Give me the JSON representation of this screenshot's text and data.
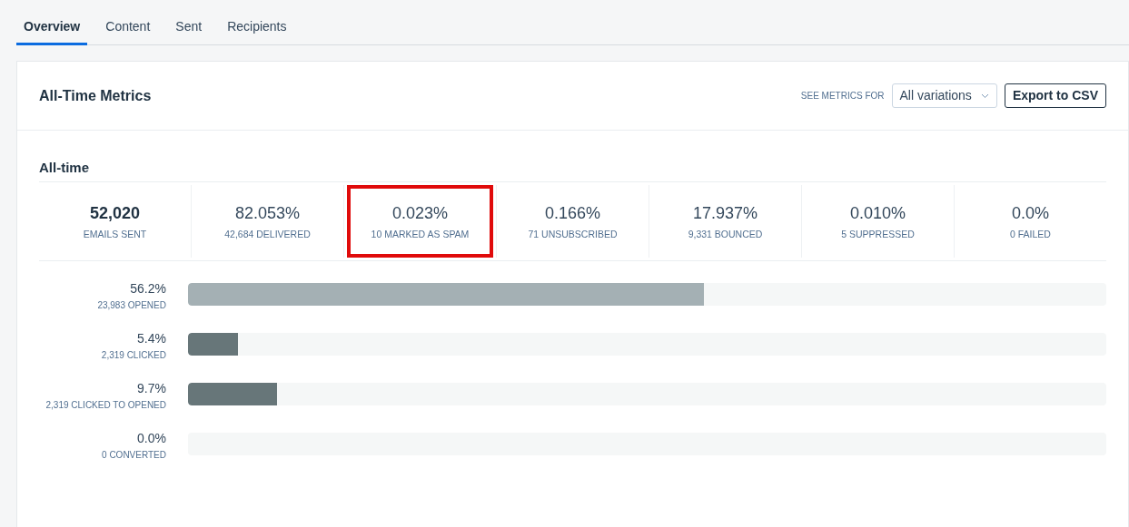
{
  "tabs": [
    {
      "label": "Overview",
      "selected": true
    },
    {
      "label": "Content",
      "selected": false
    },
    {
      "label": "Sent",
      "selected": false
    },
    {
      "label": "Recipients",
      "selected": false
    }
  ],
  "header": {
    "title": "All-Time Metrics",
    "filter_label": "SEE METRICS FOR",
    "filter_value": "All variations",
    "export_button": "Export to CSV"
  },
  "section_title": "All-time",
  "stats": [
    {
      "value": "52,020",
      "label": "EMAILS SENT",
      "highlighted": false
    },
    {
      "value": "82.053%",
      "label": "42,684 DELIVERED",
      "highlighted": false
    },
    {
      "value": "0.023%",
      "label": "10 MARKED AS SPAM",
      "highlighted": true
    },
    {
      "value": "0.166%",
      "label": "71 UNSUBSCRIBED",
      "highlighted": false
    },
    {
      "value": "17.937%",
      "label": "9,331 BOUNCED",
      "highlighted": false
    },
    {
      "value": "0.010%",
      "label": "5 SUPPRESSED",
      "highlighted": false
    },
    {
      "value": "0.0%",
      "label": "0 FAILED",
      "highlighted": false
    }
  ],
  "bars": [
    {
      "percent": "56.2%",
      "label": "23,983 OPENED",
      "level": 0.562,
      "color": "#a4b0b4"
    },
    {
      "percent": "5.4%",
      "label": "2,319 CLICKED",
      "level": 0.054,
      "color": "#677679"
    },
    {
      "percent": "9.7%",
      "label": "2,319 CLICKED TO OPENED",
      "level": 0.097,
      "color": "#677679"
    },
    {
      "percent": "0.0%",
      "label": "0 CONVERTED",
      "level": 0
    }
  ]
}
